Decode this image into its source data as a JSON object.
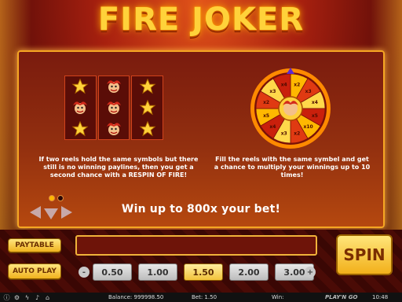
{
  "title": "FIRE JOKER",
  "info": {
    "left_text": "If two reels hold the same symbols but there still is no winning paylines, then you get a second chance with a RESPIN OF FIRE!",
    "right_text": "Fill the reels with the same symbel and get a chance to multiply your winnings up to 10 times!",
    "win_text": "Win up to 800x your bet!",
    "wheel_labels": [
      "x2",
      "x3",
      "x4",
      "x5",
      "x10",
      "x2",
      "x3",
      "x4",
      "x5",
      "x2",
      "x3",
      "x4"
    ]
  },
  "buttons": {
    "paytable": "PAYTABLE",
    "autoplay": "AUTO PLAY",
    "spin": "SPIN",
    "minus": "-",
    "plus": "+"
  },
  "bets": [
    "0.50",
    "1.00",
    "1.50",
    "2.00",
    "3.00"
  ],
  "selected_bet": "1.50",
  "status": {
    "balance": "Balance: 999998.50",
    "bet": "Bet: 1.50",
    "win": "Win:",
    "logo": "PLAY'N GO",
    "time": "10:48"
  },
  "colors": {
    "gold": "#ffd23a",
    "panel_border": "#f5a623"
  },
  "icons": [
    "info-icon",
    "settings-icon",
    "lightning-icon",
    "sound-icon",
    "home-icon"
  ]
}
